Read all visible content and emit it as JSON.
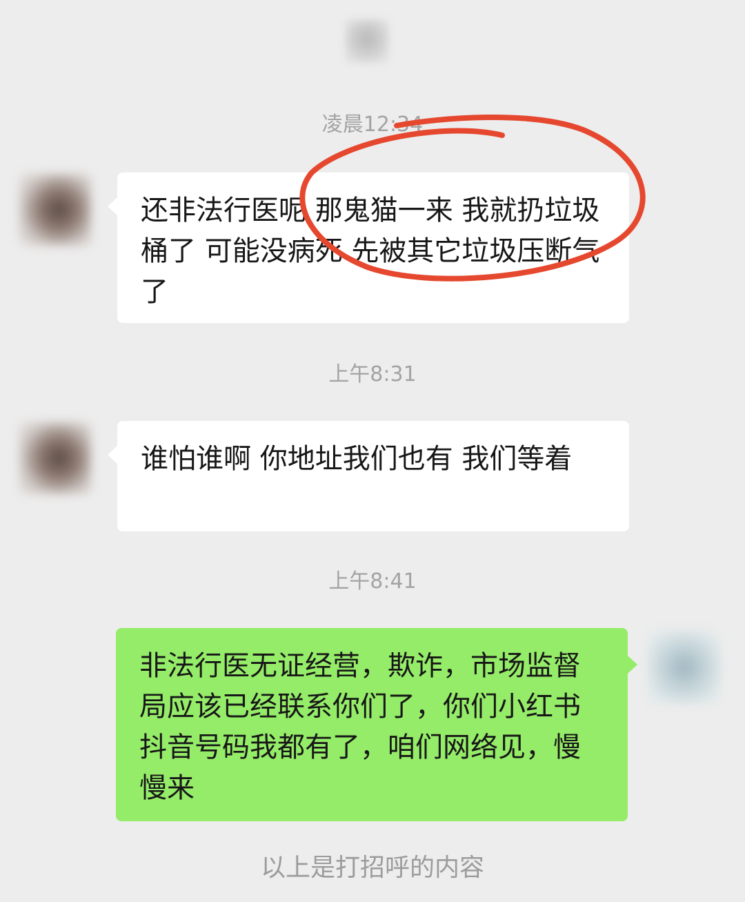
{
  "header": {
    "top_avatar_icon": "blurred-avatar"
  },
  "messages": [
    {
      "time": "凌晨12:34",
      "direction": "incoming",
      "text": "还非法行医呢 那鬼猫一来 我就扔垃圾桶了 可能没病死 先被其它垃圾压断气了"
    },
    {
      "time": "上午8:31",
      "direction": "incoming",
      "text": "谁怕谁啊 你地址我们也有 我们等着"
    },
    {
      "time": "上午8:41",
      "direction": "outgoing",
      "text": "非法行医无证经营，欺诈，市场监督局应该已经联系你们了，你们小红书抖音号码我都有了，咱们网络见，慢慢来"
    }
  ],
  "footer": {
    "note": "以上是打招呼的内容"
  },
  "colors": {
    "background": "#ededed",
    "incoming_bubble": "#ffffff",
    "outgoing_bubble": "#95ec69",
    "timestamp_text": "#a3a3a3",
    "annotation_circle": "#e5482f"
  }
}
